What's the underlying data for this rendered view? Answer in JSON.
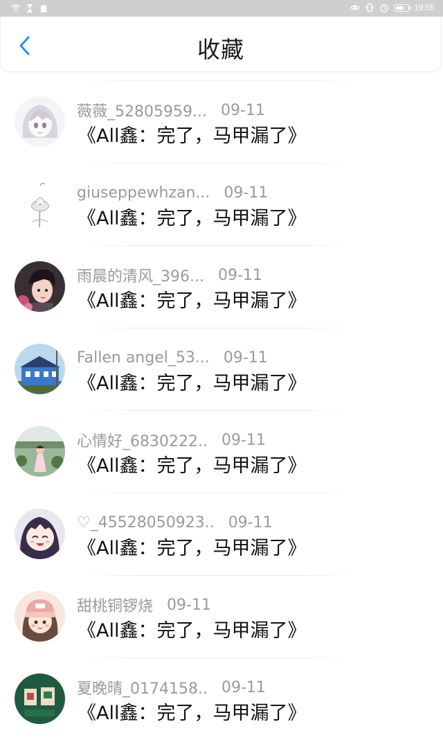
{
  "status_bar": {
    "time": "19:55",
    "battery_level": 0.7,
    "left_icons": [
      "wifi-icon",
      "hourglass-icon",
      "notification-icon"
    ],
    "right_icons": [
      "eye-icon",
      "vibrate-icon",
      "alarm-icon",
      "battery-icon"
    ]
  },
  "header": {
    "title": "收藏",
    "back_icon": "chevron-left-icon",
    "accent_color": "#2d8cf0"
  },
  "favorites": [
    {
      "user": "薇薇_52805959...",
      "date": "09-11",
      "title": "《All鑫：完了，马甲漏了》",
      "avatar": "anime-girl-sketch"
    },
    {
      "user": "giuseppewhzan...",
      "date": "09-11",
      "title": "《All鑫：完了，马甲漏了》",
      "avatar": "lotus"
    },
    {
      "user": "雨晨的清风_396...",
      "date": "09-11",
      "title": "《All鑫：完了，马甲漏了》",
      "avatar": "boy-with-flowers"
    },
    {
      "user": "Fallen angel_53...",
      "date": "09-11",
      "title": "《All鑫：完了，马甲漏了》",
      "avatar": "blue-house"
    },
    {
      "user": "心情好_6830222..",
      "date": "09-11",
      "title": "《All鑫：完了，马甲漏了》",
      "avatar": "girl-in-garden"
    },
    {
      "user": "♡_45528050923..",
      "date": "09-11",
      "title": "《All鑫：完了，马甲漏了》",
      "avatar": "anime-girl-smiling"
    },
    {
      "user": "甜桃铜锣烧",
      "date": "09-11",
      "title": "《All鑫：完了，马甲漏了》",
      "avatar": "girl-with-beanie"
    },
    {
      "user": "夏晚晴_0174158..",
      "date": "09-11",
      "title": "《All鑫：完了，马甲漏了》",
      "avatar": "green-cards"
    }
  ]
}
